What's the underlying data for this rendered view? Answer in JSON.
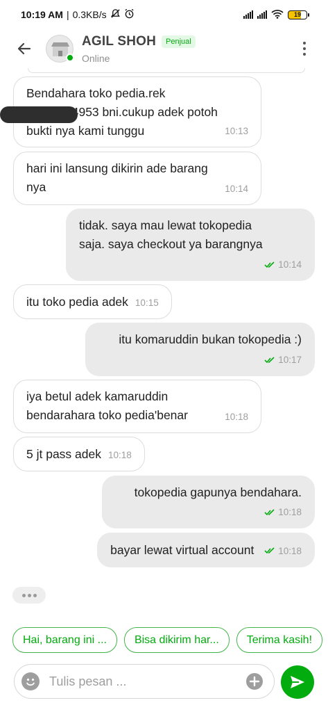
{
  "status_bar": {
    "time": "10:19 AM",
    "network_speed": "0.3KB/s",
    "battery": "19"
  },
  "header": {
    "name": "AGIL SHOH",
    "badge": "Penjual",
    "status": "Online"
  },
  "colors": {
    "accent": "#03ac0e",
    "outgoing_bubble": "#eaeaea",
    "incoming_border": "#dcdcdc"
  },
  "messages": [
    {
      "dir": "in",
      "lines": [
        "Bendahara toko pedia.rek",
        "34953 bni.cukup adek potoh",
        "bukti nya kami tunggu"
      ],
      "time": "10:13",
      "redacted": true
    },
    {
      "dir": "in",
      "lines": [
        "hari ini lansung dikirin ade barang",
        "nya"
      ],
      "time": "10:14"
    },
    {
      "dir": "out",
      "lines": [
        "tidak. saya mau lewat tokopedia",
        "saja. saya checkout ya barangnya"
      ],
      "time": "10:14",
      "read": true
    },
    {
      "dir": "in",
      "lines": [
        "itu toko pedia adek"
      ],
      "time": "10:15"
    },
    {
      "dir": "out",
      "lines": [
        "itu komaruddin bukan tokopedia :)"
      ],
      "time": "10:17",
      "read": true
    },
    {
      "dir": "in",
      "lines": [
        "iya betul adek kamaruddin",
        "bendarahara toko pedia'benar"
      ],
      "time": "10:18"
    },
    {
      "dir": "in",
      "lines": [
        "5 jt pass adek"
      ],
      "time": "10:18"
    },
    {
      "dir": "out",
      "lines": [
        "tokopedia gapunya bendahara."
      ],
      "time": "10:18",
      "read": true
    },
    {
      "dir": "out",
      "lines": [
        "bayar lewat virtual account"
      ],
      "time": "10:18",
      "read": true
    }
  ],
  "quick_replies": [
    "Hai, barang ini ...",
    "Bisa dikirim har...",
    "Terima kasih!"
  ],
  "composer": {
    "placeholder": "Tulis pesan ..."
  },
  "icons": {
    "back": "arrow-left-icon",
    "more": "kebab-menu-icon",
    "emoji": "smiley-icon",
    "attach": "plus-circle-icon",
    "send": "send-icon",
    "read": "double-check-icon"
  }
}
